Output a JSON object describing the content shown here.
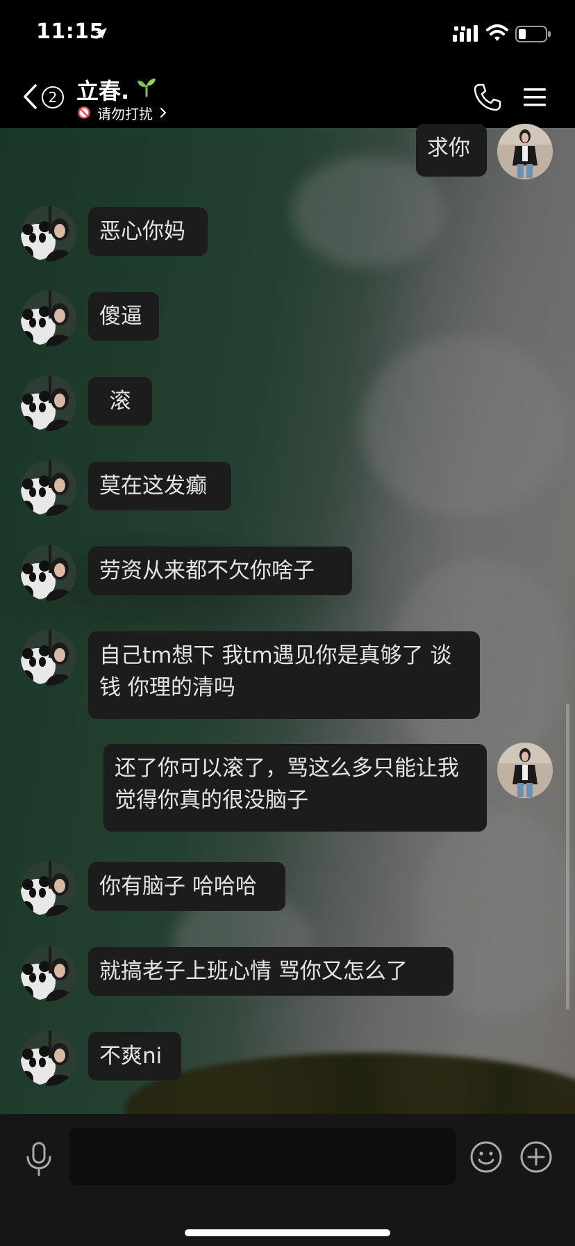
{
  "status_bar": {
    "time": "11:15"
  },
  "nav": {
    "unread_count": "2",
    "contact_name": "立春.",
    "status_text": "请勿打扰"
  },
  "messages": [
    {
      "sender": "me",
      "text": "求你"
    },
    {
      "sender": "contact",
      "text": "恶心你妈"
    },
    {
      "sender": "contact",
      "text": "傻逼"
    },
    {
      "sender": "contact",
      "text": "滚"
    },
    {
      "sender": "contact",
      "text": "莫在这发癫"
    },
    {
      "sender": "contact",
      "text": "劳资从来都不欠你啥子"
    },
    {
      "sender": "contact",
      "text": "自己tm想下 我tm遇见你是真够了 谈钱 你理的清吗"
    },
    {
      "sender": "me",
      "text": "还了你可以滚了，骂这么多只能让我觉得你真的很没脑子"
    },
    {
      "sender": "contact",
      "text": "你有脑子 哈哈哈"
    },
    {
      "sender": "contact",
      "text": "就搞老子上班心情 骂你又怎么了"
    },
    {
      "sender": "contact",
      "text": "不爽ni"
    }
  ],
  "input": {
    "value": ""
  },
  "icons": {
    "back": "chevron-left-icon",
    "status": "do-not-disturb-icon",
    "name_emoji": "sprout-icon",
    "call": "phone-icon",
    "menu": "hamburger-menu-icon",
    "voice": "microphone-icon",
    "emoji": "smiley-face-icon",
    "add": "plus-circle-icon"
  },
  "colors": {
    "bubble_bg": "#1c1c1c",
    "bubble_text": "#e4e4e4",
    "bar_bg": "#000000",
    "input_bar_bg": "#161616",
    "dnd_red": "#f04a5a",
    "sprout_green": "#7fc34b"
  }
}
